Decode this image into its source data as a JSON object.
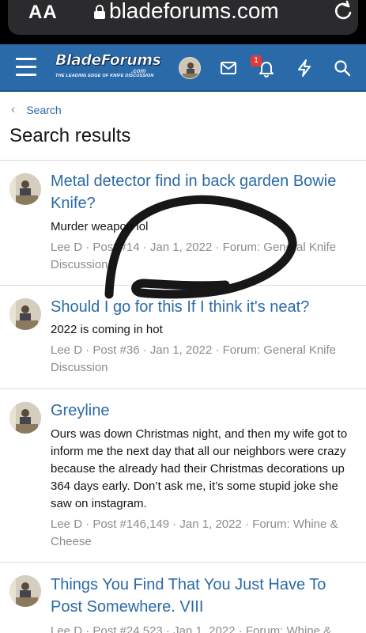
{
  "browser": {
    "text_size_label": "AA",
    "url": "bladeforums.com"
  },
  "header": {
    "logo_text": "BladeForums",
    "logo_suffix": ".com",
    "logo_tagline": "THE LEADING EDGE OF KNIFE DISCUSSION",
    "alerts_count": "1",
    "accent_color": "#2b6aa8",
    "badge_color": "#e53935"
  },
  "breadcrumb": {
    "label": "Search"
  },
  "page_title": "Search results",
  "results": [
    {
      "title": "Metal detector find in back garden Bowie Knife?",
      "snippet": "Murder weapon lol",
      "meta": "Lee D · Post #14 · Jan 1, 2022 · Forum: General Knife Discussion"
    },
    {
      "title": "Should I go for this If I think it's neat?",
      "snippet": "2022 is coming in hot",
      "meta": "Lee D · Post #36 · Jan 1, 2022 · Forum: General Knife Discussion"
    },
    {
      "title": "Greyline",
      "snippet": "Ours was down Christmas night, and then my wife got to inform me the next day that all our neighbors were crazy because the already had their Christmas decorations up 364 days early. Don’t ask me, it’s some stupid joke she saw on instagram.",
      "meta": "Lee D · Post #146,149 · Jan 1, 2022 · Forum: Whine & Cheese"
    },
    {
      "title": "Things You Find That You Just Have To Post Somewhere. VIII",
      "snippet": "",
      "meta": "Lee D · Post #24,523 · Jan 1, 2022 · Forum: Whine &"
    }
  ]
}
